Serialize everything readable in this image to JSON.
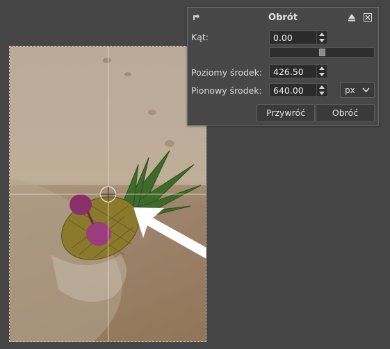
{
  "dialog": {
    "title": "Obrót",
    "labels": {
      "angle": "Kąt:",
      "center_x": "Poziomy środek:",
      "center_y": "Pionowy środek:"
    },
    "values": {
      "angle": "0.00",
      "center_x": "426.50",
      "center_y": "640.00"
    },
    "unit": "px",
    "angle_slider_fraction": 0.5,
    "buttons": {
      "reset": "Przywróć",
      "rotate": "Obróć"
    },
    "icons": {
      "dialog": "rotate-tool-icon",
      "detach": "detach-icon",
      "close": "close-icon"
    }
  },
  "colors": {
    "background": "#454545",
    "dialog_bg": "#474747",
    "field_bg": "#2b2b2b"
  }
}
